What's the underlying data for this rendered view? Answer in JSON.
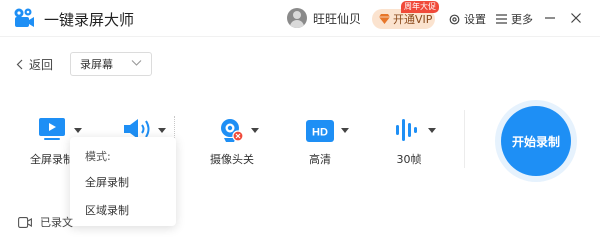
{
  "app": {
    "title": "一键录屏大师"
  },
  "header": {
    "username": "旺旺仙贝",
    "vip_label": "开通VIP",
    "promo_badge": "周年大促",
    "settings_label": "设置",
    "more_label": "更多"
  },
  "nav": {
    "back_label": "返回",
    "mode_select_value": "录屏幕"
  },
  "toolbar": {
    "tools": [
      {
        "label": "全屏录制",
        "icon": "screen-record-icon"
      },
      {
        "label": "",
        "icon": "speaker-icon"
      },
      {
        "label": "摄像头关",
        "icon": "webcam-off-icon"
      },
      {
        "label": "高清",
        "icon": "hd-quality-icon"
      },
      {
        "label": "30帧",
        "icon": "framerate-icon"
      }
    ],
    "start_label": "开始录制"
  },
  "mode_menu": {
    "heading": "模式:",
    "items": [
      "全屏录制",
      "区域录制"
    ]
  },
  "footer": {
    "recorded_label": "已录文"
  },
  "colors": {
    "accent": "#1e8ff5",
    "vip_bg": "#fbe3cf",
    "promo": "#f04a3a",
    "cam_off": "#f04a3a"
  }
}
